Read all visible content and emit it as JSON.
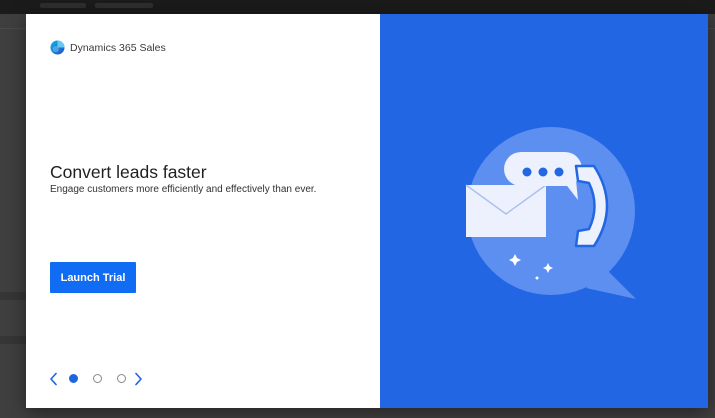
{
  "app": {
    "name": "Dynamics 365 Sales"
  },
  "slide": {
    "headline": "Convert leads faster",
    "subline": "Engage customers more efficiently and effectively than ever."
  },
  "cta": {
    "label": "Launch Trial"
  },
  "pager": {
    "total": 3,
    "current": 1
  },
  "colors": {
    "accent": "#2266e3",
    "button": "#0f6cf3",
    "dot_active": "#1f64e0"
  },
  "icons": {
    "brand": "dynamics-365-logo-icon",
    "prev": "chevron-left-icon",
    "next": "chevron-right-icon",
    "illustration": [
      "speech-bubble-icon",
      "envelope-icon",
      "chat-dots-icon",
      "phone-handset-icon",
      "sparkle-icon"
    ]
  }
}
